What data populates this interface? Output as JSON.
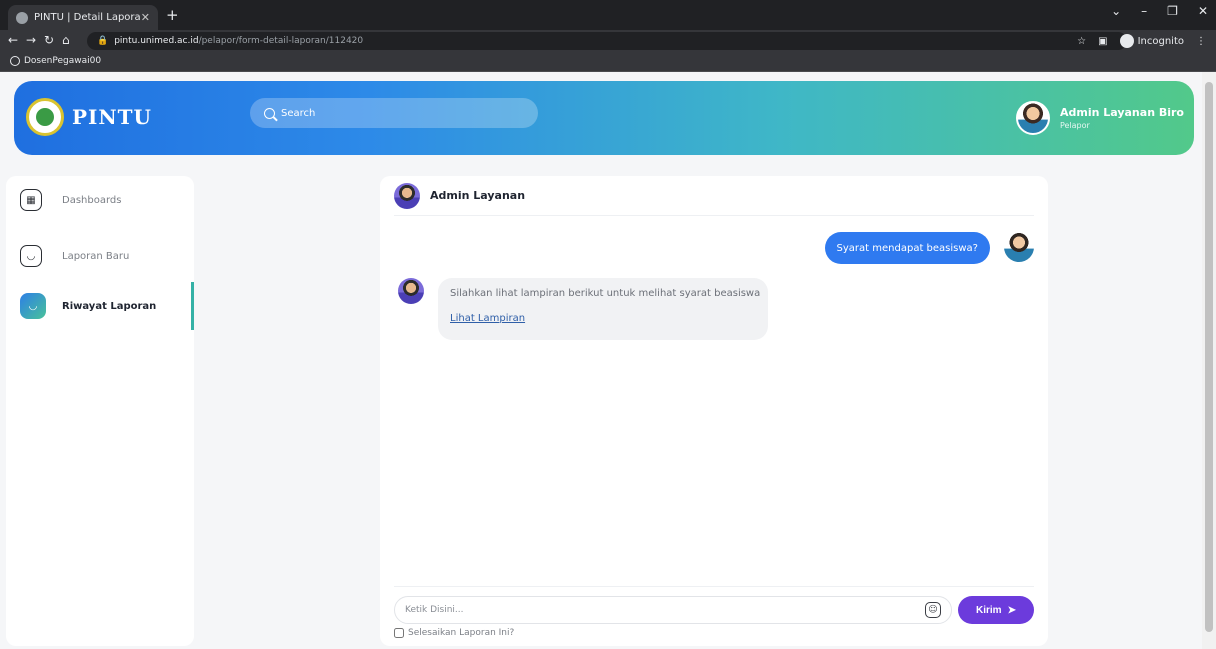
{
  "browser": {
    "tab_title": "PINTU | Detail Laporan",
    "url_host": "pintu.unimed.ac.id",
    "url_path": "/pelapor/form-detail-laporan/112420",
    "incognito_label": "Incognito",
    "bookmark": "DosenPegawai00"
  },
  "header": {
    "brand": "PINTU",
    "search_placeholder": "Search",
    "user_name": "Admin Layanan Biro",
    "user_role": "Pelapor"
  },
  "sidebar": {
    "items": [
      {
        "label": "Dashboards",
        "icon": "dashboard-icon"
      },
      {
        "label": "Laporan Baru",
        "icon": "inbox-icon"
      },
      {
        "label": "Riwayat Laporan",
        "icon": "inbox-icon"
      }
    ],
    "active_index": 2
  },
  "chat": {
    "title": "Admin Layanan",
    "messages": [
      {
        "from": "me",
        "text": "Syarat mendapat beasiswa?"
      },
      {
        "from": "admin",
        "text": "Silahkan lihat lampiran berikut untuk melihat syarat beasiswa",
        "link": "Lihat Lampiran"
      }
    ],
    "input_placeholder": "Ketik Disini...",
    "send_label": "Kirim",
    "finish_label": "Selesaikan Laporan Ini?"
  },
  "colors": {
    "hero_start": "#1f6fe0",
    "hero_end": "#52c98a",
    "bubble_out": "#2f7af0",
    "send_button": "#6c3bdc"
  }
}
